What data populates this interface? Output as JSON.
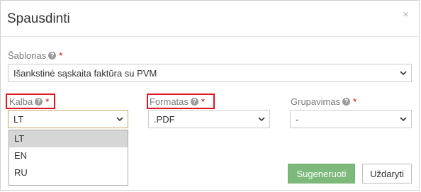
{
  "dialog": {
    "title": "Spausdinti",
    "close_icon": "×"
  },
  "template_field": {
    "label": "Šablonas",
    "required_mark": "*",
    "help_icon": "?",
    "value": "Išankstinė sąskaita faktūra su PVM"
  },
  "language_field": {
    "label": "Kalba",
    "required_mark": "*",
    "help_icon": "?",
    "value": "LT",
    "options": [
      "LT",
      "EN",
      "RU"
    ],
    "selected_index": 0
  },
  "format_field": {
    "label": "Formatas",
    "required_mark": "*",
    "help_icon": "?",
    "value": ".PDF"
  },
  "grouping_field": {
    "label": "Grupavimas",
    "required_mark": "*",
    "help_icon": "?",
    "value": "-"
  },
  "buttons": {
    "generate": "Sugeneruoti",
    "close": "Uždaryti"
  },
  "colors": {
    "primary_button": "#7cb97a",
    "required": "#cc0000",
    "highlight_box": "#e0141e",
    "selected_option": "#d6d6d6"
  }
}
